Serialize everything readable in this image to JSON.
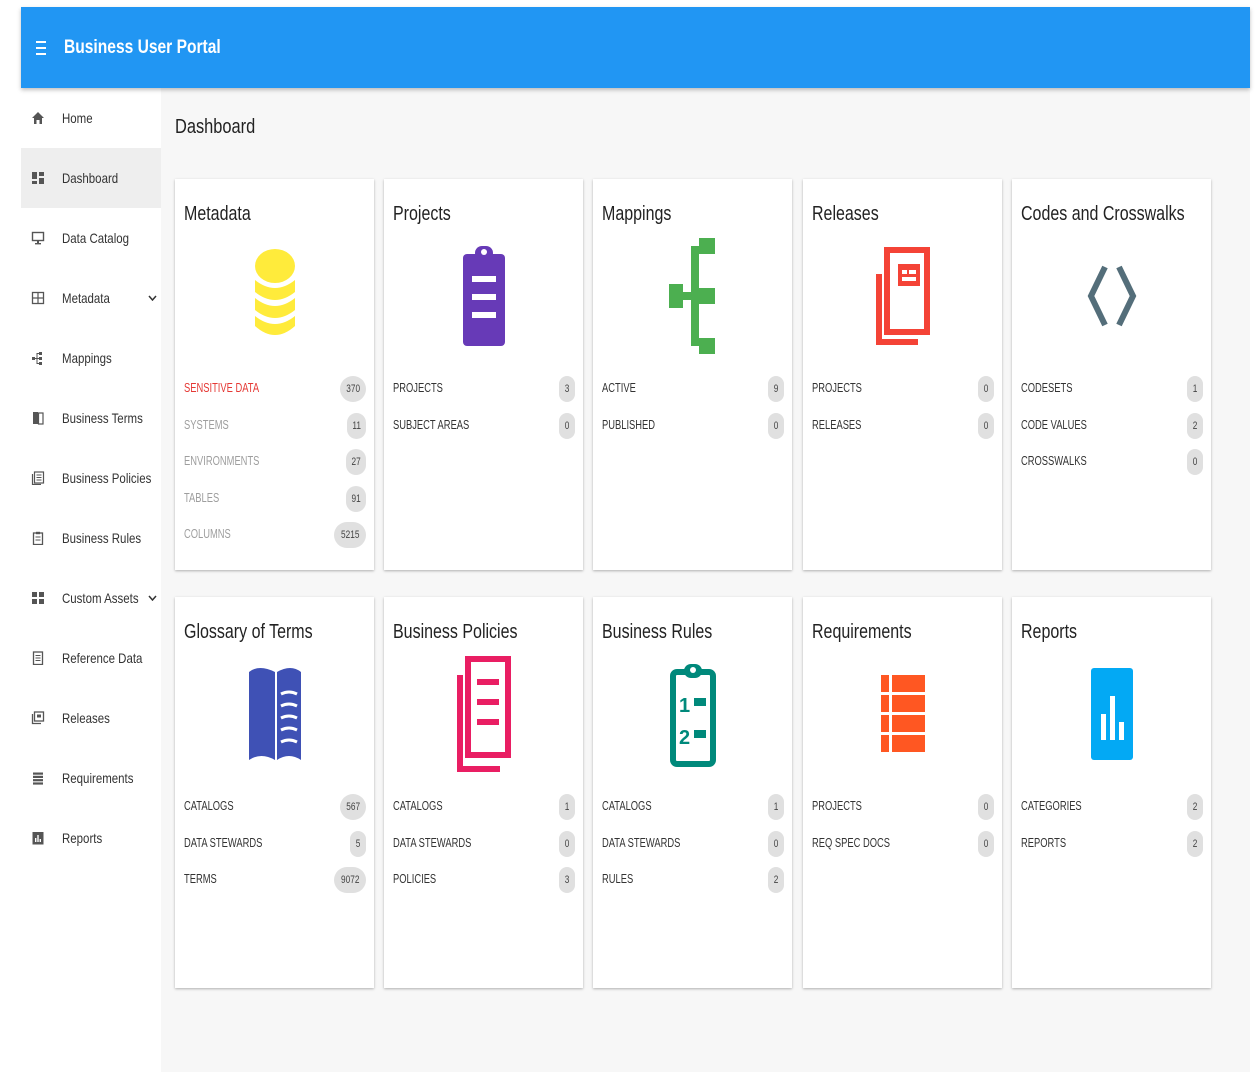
{
  "app": {
    "title": "Business User Portal"
  },
  "colors": {
    "topbar": "#2196f3",
    "metadata": "#ffeb3b",
    "projects": "#673ab7",
    "mappings": "#4caf50",
    "releases": "#f44336",
    "codes": "#546e7a",
    "glossary": "#3f51b5",
    "policies": "#e91e63",
    "rules": "#00897b",
    "requirements": "#ff5722",
    "reports": "#03a9f4",
    "alert_text": "#e53935"
  },
  "sidebar": {
    "items": [
      {
        "label": "Home",
        "icon": "home-icon",
        "active": false,
        "expandable": false
      },
      {
        "label": "Dashboard",
        "icon": "dashboard-icon",
        "active": true,
        "expandable": false
      },
      {
        "label": "Data Catalog",
        "icon": "monitor-icon",
        "active": false,
        "expandable": false
      },
      {
        "label": "Metadata",
        "icon": "grid-icon",
        "active": false,
        "expandable": true
      },
      {
        "label": "Mappings",
        "icon": "hierarchy-icon",
        "active": false,
        "expandable": false
      },
      {
        "label": "Business Terms",
        "icon": "book-icon",
        "active": false,
        "expandable": false
      },
      {
        "label": "Business Policies",
        "icon": "documents-icon",
        "active": false,
        "expandable": false
      },
      {
        "label": "Business Rules",
        "icon": "clipboard-icon",
        "active": false,
        "expandable": false
      },
      {
        "label": "Custom Assets",
        "icon": "widgets-icon",
        "active": false,
        "expandable": true
      },
      {
        "label": "Reference Data",
        "icon": "document-icon",
        "active": false,
        "expandable": false
      },
      {
        "label": "Releases",
        "icon": "release-icon",
        "active": false,
        "expandable": false
      },
      {
        "label": "Requirements",
        "icon": "list-icon",
        "active": false,
        "expandable": false
      },
      {
        "label": "Reports",
        "icon": "report-icon",
        "active": false,
        "expandable": false
      }
    ]
  },
  "main": {
    "title": "Dashboard",
    "cards": [
      {
        "title": "Metadata",
        "icon": "database-icon",
        "stats": [
          {
            "label": "SENSITIVE DATA",
            "value": "370",
            "style": "alert"
          },
          {
            "label": "SYSTEMS",
            "value": "11",
            "style": "muted"
          },
          {
            "label": "ENVIRONMENTS",
            "value": "27",
            "style": "muted"
          },
          {
            "label": "TABLES",
            "value": "91",
            "style": "muted"
          },
          {
            "label": "COLUMNS",
            "value": "5215",
            "style": "muted"
          }
        ]
      },
      {
        "title": "Projects",
        "icon": "clipboard-list-icon",
        "stats": [
          {
            "label": "PROJECTS",
            "value": "3",
            "style": ""
          },
          {
            "label": "SUBJECT AREAS",
            "value": "0",
            "style": ""
          }
        ]
      },
      {
        "title": "Mappings",
        "icon": "mapping-tree-icon",
        "stats": [
          {
            "label": "ACTIVE",
            "value": "9",
            "style": ""
          },
          {
            "label": "PUBLISHED",
            "value": "0",
            "style": ""
          }
        ]
      },
      {
        "title": "Releases",
        "icon": "release-stack-icon",
        "stats": [
          {
            "label": "PROJECTS",
            "value": "0",
            "style": ""
          },
          {
            "label": "RELEASES",
            "value": "0",
            "style": ""
          }
        ]
      },
      {
        "title": "Codes and Crosswalks",
        "icon": "code-brackets-icon",
        "stats": [
          {
            "label": "CODESETS",
            "value": "1",
            "style": ""
          },
          {
            "label": "CODE VALUES",
            "value": "2",
            "style": ""
          },
          {
            "label": "CROSSWALKS",
            "value": "0",
            "style": ""
          }
        ]
      },
      {
        "title": "Glossary of Terms",
        "icon": "open-book-icon",
        "stats": [
          {
            "label": "CATALOGS",
            "value": "567",
            "style": ""
          },
          {
            "label": "DATA STEWARDS",
            "value": "5",
            "style": ""
          },
          {
            "label": "TERMS",
            "value": "9072",
            "style": ""
          }
        ]
      },
      {
        "title": "Business Policies",
        "icon": "policy-stack-icon",
        "stats": [
          {
            "label": "CATALOGS",
            "value": "1",
            "style": ""
          },
          {
            "label": "DATA STEWARDS",
            "value": "0",
            "style": ""
          },
          {
            "label": "POLICIES",
            "value": "3",
            "style": ""
          }
        ]
      },
      {
        "title": "Business Rules",
        "icon": "rules-clipboard-icon",
        "stats": [
          {
            "label": "CATALOGS",
            "value": "1",
            "style": ""
          },
          {
            "label": "DATA STEWARDS",
            "value": "0",
            "style": ""
          },
          {
            "label": "RULES",
            "value": "2",
            "style": ""
          }
        ]
      },
      {
        "title": "Requirements",
        "icon": "requirements-list-icon",
        "stats": [
          {
            "label": "PROJECTS",
            "value": "0",
            "style": ""
          },
          {
            "label": "REQ SPEC DOCS",
            "value": "0",
            "style": ""
          }
        ]
      },
      {
        "title": "Reports",
        "icon": "bar-chart-icon",
        "stats": [
          {
            "label": "CATEGORIES",
            "value": "2",
            "style": ""
          },
          {
            "label": "REPORTS",
            "value": "2",
            "style": ""
          }
        ]
      }
    ]
  }
}
